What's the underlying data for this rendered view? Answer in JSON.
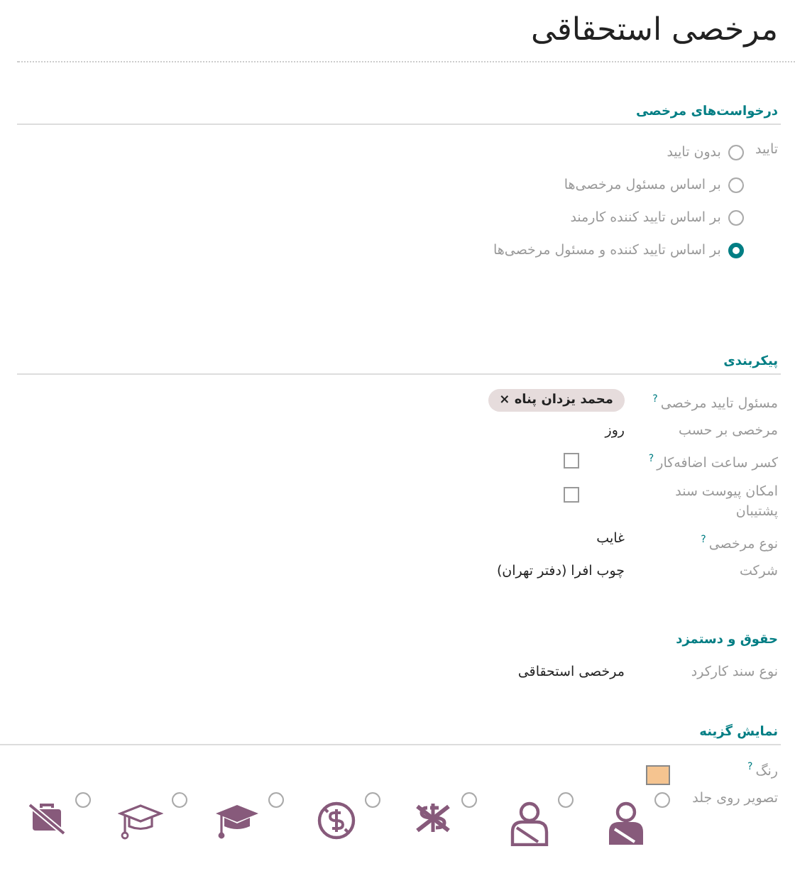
{
  "title": "مرخصی استحقاقی",
  "requests": {
    "heading": "درخواست‌های مرخصی",
    "label": "تایید",
    "options": [
      {
        "label": "بدون تایید",
        "selected": false
      },
      {
        "label": "بر اساس مسئول مرخصی‌ها",
        "selected": false
      },
      {
        "label": "بر اساس تایید کننده کارمند",
        "selected": false
      },
      {
        "label": "بر اساس تایید کننده و مسئول مرخصی‌ها",
        "selected": true
      }
    ]
  },
  "config": {
    "heading": "پیکربندی",
    "fields": [
      {
        "kind": "tag",
        "label": "مسئول تایید مرخصی",
        "help": "?",
        "value": "محمد یزدان پناه",
        "remove": "×"
      },
      {
        "kind": "text",
        "label": "مرخصی بر حسب",
        "value": "روز"
      },
      {
        "kind": "checkbox",
        "label": "کسر ساعت اضافه‌کار",
        "help": "?",
        "checked": false
      },
      {
        "kind": "checkbox",
        "label": "امکان پیوست سند پشتیبان",
        "checked": false
      },
      {
        "kind": "text",
        "label": "نوع مرخصی",
        "help": "?",
        "value": "غایب"
      },
      {
        "kind": "text",
        "label": "شرکت",
        "value": "چوب افرا (دفتر تهران)"
      }
    ]
  },
  "payroll": {
    "heading": "حقوق و دستمزد",
    "fields": [
      {
        "kind": "text",
        "label": "نوع سند کارکرد",
        "value": "مرخصی استحقاقی"
      }
    ]
  },
  "display": {
    "heading": "نمایش گزینه",
    "color_label": "رنگ",
    "color_help": "?",
    "color": "#f5c490",
    "cover_label": "تصویر روی جلد",
    "covers": [
      {
        "selected": false
      },
      {
        "selected": false
      },
      {
        "selected": false
      },
      {
        "selected": false
      },
      {
        "selected": false
      },
      {
        "selected": false
      },
      {
        "selected": false
      }
    ]
  }
}
